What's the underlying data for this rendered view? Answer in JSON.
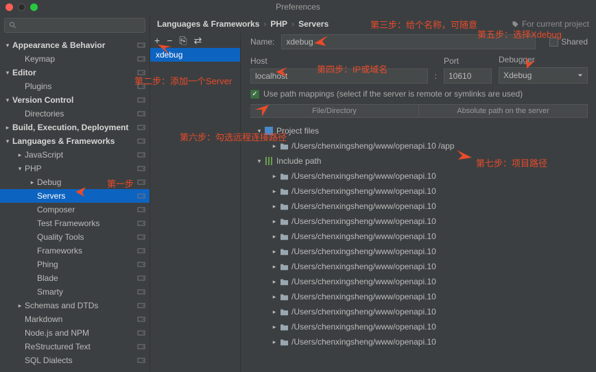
{
  "window": {
    "title": "Preferences"
  },
  "breadcrumbs": {
    "a": "Languages & Frameworks",
    "b": "PHP",
    "c": "Servers",
    "project_hint": "For current project"
  },
  "sidebar": {
    "items": [
      {
        "label": "Appearance & Behavior",
        "d": 0,
        "exp": "▾",
        "bold": true
      },
      {
        "label": "Keymap",
        "d": 1,
        "exp": "",
        "bold": false
      },
      {
        "label": "Editor",
        "d": 0,
        "exp": "▾",
        "bold": true
      },
      {
        "label": "Plugins",
        "d": 1,
        "exp": "",
        "bold": false
      },
      {
        "label": "Version Control",
        "d": 0,
        "exp": "▾",
        "bold": true
      },
      {
        "label": "Directories",
        "d": 1,
        "exp": "",
        "bold": false
      },
      {
        "label": "Build, Execution, Deployment",
        "d": 0,
        "exp": "▸",
        "bold": true
      },
      {
        "label": "Languages & Frameworks",
        "d": 0,
        "exp": "▾",
        "bold": true
      },
      {
        "label": "JavaScript",
        "d": 1,
        "exp": "▸",
        "bold": false
      },
      {
        "label": "PHP",
        "d": 1,
        "exp": "▾",
        "bold": false
      },
      {
        "label": "Debug",
        "d": 2,
        "exp": "▸",
        "bold": false
      },
      {
        "label": "Servers",
        "d": 2,
        "exp": "",
        "bold": false,
        "sel": true
      },
      {
        "label": "Composer",
        "d": 2,
        "exp": "",
        "bold": false
      },
      {
        "label": "Test Frameworks",
        "d": 2,
        "exp": "",
        "bold": false
      },
      {
        "label": "Quality Tools",
        "d": 2,
        "exp": "",
        "bold": false
      },
      {
        "label": "Frameworks",
        "d": 2,
        "exp": "",
        "bold": false
      },
      {
        "label": "Phing",
        "d": 2,
        "exp": "",
        "bold": false
      },
      {
        "label": "Blade",
        "d": 2,
        "exp": "",
        "bold": false
      },
      {
        "label": "Smarty",
        "d": 2,
        "exp": "",
        "bold": false
      },
      {
        "label": "Schemas and DTDs",
        "d": 1,
        "exp": "▸",
        "bold": false
      },
      {
        "label": "Markdown",
        "d": 1,
        "exp": "",
        "bold": false
      },
      {
        "label": "Node.js and NPM",
        "d": 1,
        "exp": "",
        "bold": false
      },
      {
        "label": "ReStructured Text",
        "d": 1,
        "exp": "",
        "bold": false
      },
      {
        "label": "SQL Dialects",
        "d": 1,
        "exp": "",
        "bold": false
      }
    ]
  },
  "server_toolbar": {
    "add": "+",
    "remove": "−",
    "copy": "⎘",
    "paste": "⇄"
  },
  "server_list": {
    "name": "xdebug"
  },
  "form": {
    "name_label": "Name:",
    "name_value": "xdebug",
    "shared_label": "Shared",
    "host_label": "Host",
    "host_value": "localhost",
    "port_label": "Port",
    "port_value": "10610",
    "debugger_label": "Debugger",
    "debugger_value": "Xdebug",
    "mappings_label": "Use path mappings (select if the server is remote or symlinks are used)"
  },
  "table": {
    "col1": "File/Directory",
    "col2": "Absolute path on the server"
  },
  "files": {
    "root": "Project files",
    "app": "/Users/chenxingsheng/www/openapi.10 /app",
    "include": "Include path",
    "paths": [
      "/Users/chenxingsheng/www/openapi.10",
      "/Users/chenxingsheng/www/openapi.10",
      "/Users/chenxingsheng/www/openapi.10",
      "/Users/chenxingsheng/www/openapi.10",
      "/Users/chenxingsheng/www/openapi.10",
      "/Users/chenxingsheng/www/openapi.10",
      "/Users/chenxingsheng/www/openapi.10",
      "/Users/chenxingsheng/www/openapi.10",
      "/Users/chenxingsheng/www/openapi.10",
      "/Users/chenxingsheng/www/openapi.10",
      "/Users/chenxingsheng/www/openapi.10",
      "/Users/chenxingsheng/www/openapi.10"
    ]
  },
  "annotations": {
    "step1": "第一步",
    "step2": "第二步：添加一个Server",
    "step3": "第三步：给个名称，可随意",
    "step4": "第四步：IP或域名",
    "step5": "第五步：选择Xdebug",
    "step6": "第六步：勾选远程连接路径",
    "step7": "第七步：项目路径"
  }
}
